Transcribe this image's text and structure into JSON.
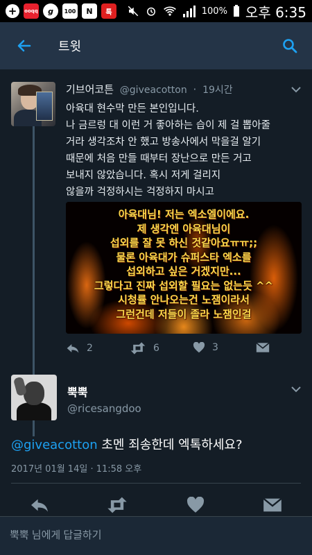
{
  "status_bar": {
    "app_icons": [
      "add-icon",
      "ooqq-icon",
      "g-icon",
      "battery-100-icon",
      "n-icon",
      "talk-icon"
    ],
    "battery": "100%",
    "time": "오후 6:35"
  },
  "app_bar": {
    "title": "트윗",
    "back_icon": "arrow-left-icon",
    "search_icon": "search-icon"
  },
  "parent_tweet": {
    "name": "기브어코튼",
    "handle": "@giveacotton",
    "separator": "·",
    "time": "19시간",
    "text_lines": [
      "아육대 현수막 만든 본인입니다.",
      "나 금르렁 대 이런 거 좋아하는 습이 제 걸 뽑아줄",
      "거라 생각조차 안 했고 방송사에서 막을걸 알기",
      "때문에 처음 만들 때부터 장난으로 만든 거고",
      "보내지 않았습니다. 혹시 저게 걸리지",
      "않을까 걱정하시는 걱정하지 마시고"
    ],
    "image_lines": [
      "아육대님! 저는 엑소엘이에요.",
      "제 생각엔 아육대님이",
      "섭외를 잘 못 하신 것같아요ㅠㅠ;;",
      "물론 아육대가 슈퍼스타 엑소를",
      "섭외하고 싶은 거겠지만...",
      "그렇다고 진짜 섭외할 필요는 없는듯 ^^",
      "시청률 안나오는건 노잼이라서",
      "그런건데 저들이 졸라 노잼인걸"
    ],
    "actions": {
      "reply_count": "2",
      "retweet_count": "6",
      "like_count": "3"
    }
  },
  "main_tweet": {
    "name": "뿍뿍",
    "handle": "@ricesangdoo",
    "mention": "@giveacotton",
    "text": " 초멘 죄송한데 엑톡하세요?",
    "date": "2017년 01월 14일 · 11:58 오후"
  },
  "reply_bar": {
    "placeholder": "뿍뿍 님에게 답글하기"
  },
  "colors": {
    "background": "#141d26",
    "app_bar": "#243447",
    "accent": "#1da1f2",
    "secondary_text": "#8899a6"
  }
}
